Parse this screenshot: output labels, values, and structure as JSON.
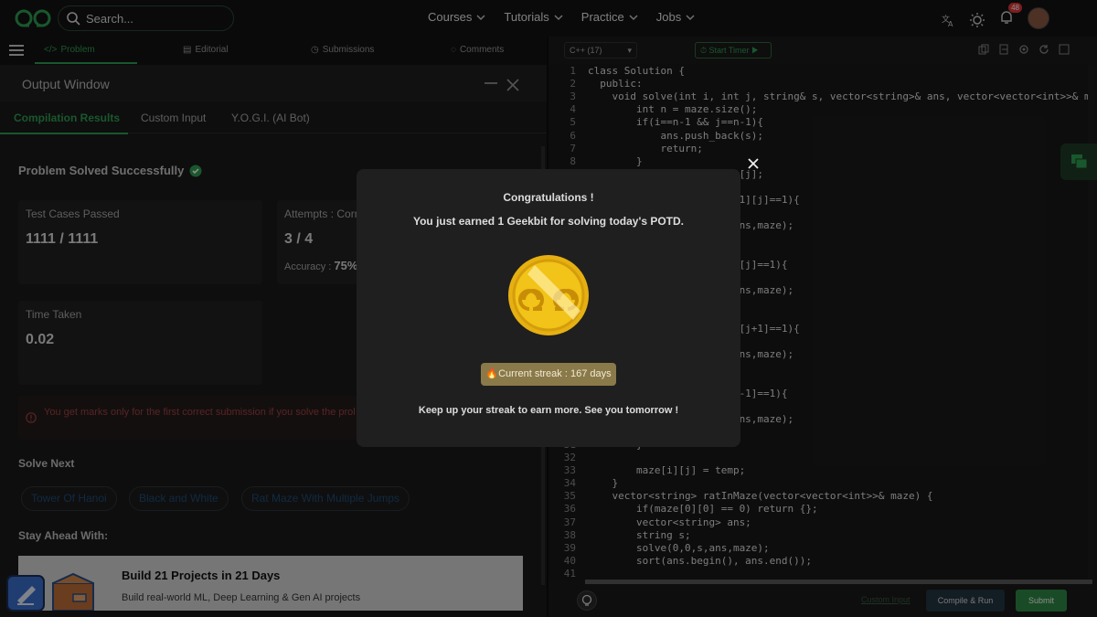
{
  "header": {
    "search_placeholder": "Search...",
    "nav": [
      "Courses",
      "Tutorials",
      "Practice",
      "Jobs"
    ],
    "notification_count": "48"
  },
  "problem_tabs": [
    "Problem",
    "Editorial",
    "Submissions",
    "Comments"
  ],
  "output_window": {
    "title": "Output Window",
    "tabs": [
      "Compilation Results",
      "Custom Input",
      "Y.O.G.I. (AI Bot)"
    ],
    "status": "Problem Solved Successfully",
    "test_cases_label": "Test Cases Passed",
    "test_cases_value": "1111 / 1111",
    "attempts_label": "Attempts : Corr",
    "attempts_value": "3 / 4",
    "accuracy_label": "Accuracy :",
    "accuracy_value": "75%",
    "time_label": "Time Taken",
    "time_value": "0.02",
    "warning": "You get marks only for the first correct submission if you solve the prol solution.",
    "solve_next_label": "Solve Next",
    "solve_next": [
      "Tower Of Hanoi",
      "Black and White",
      "Rat Maze With Multiple Jumps"
    ],
    "stay_ahead_label": "Stay Ahead With:",
    "banner_title": "Build 21 Projects in 21 Days",
    "banner_sub": "Build real-world ML, Deep Learning & Gen AI projects"
  },
  "editor": {
    "language": "C++ (17)",
    "timer_label": "Start Timer",
    "custom_input": "Custom Input",
    "compile_label": "Compile & Run",
    "submit_label": "Submit",
    "lines": [
      {
        "n": "1",
        "t": "class Solution {"
      },
      {
        "n": "2",
        "t": "  public:"
      },
      {
        "n": "3",
        "t": "    void solve(int i, int j, string& s, vector<string>& ans, vector<vector<int>>& maze"
      },
      {
        "n": "4",
        "t": "        int n = maze.size();"
      },
      {
        "n": "5",
        "t": "        if(i==n-1 && j==n-1){"
      },
      {
        "n": "6",
        "t": "            ans.push_back(s);"
      },
      {
        "n": "7",
        "t": "            return;"
      },
      {
        "n": "8",
        "t": "        }"
      },
      {
        "n": "",
        "t": "                        ][j];"
      },
      {
        "n": "",
        "t": ""
      },
      {
        "n": "",
        "t": "                        +1][j]==1){"
      },
      {
        "n": "",
        "t": ""
      },
      {
        "n": "",
        "t": "                        ans,maze);"
      },
      {
        "n": "",
        "t": ""
      },
      {
        "n": "",
        "t": ""
      },
      {
        "n": "",
        "t": "                        ][j]==1){"
      },
      {
        "n": "",
        "t": ""
      },
      {
        "n": "",
        "t": "                        ans,maze);"
      },
      {
        "n": "",
        "t": ""
      },
      {
        "n": "",
        "t": ""
      },
      {
        "n": "",
        "t": "                        ][j+1]==1){"
      },
      {
        "n": "",
        "t": ""
      },
      {
        "n": "",
        "t": "                        ans,maze);"
      },
      {
        "n": "",
        "t": ""
      },
      {
        "n": "",
        "t": ""
      },
      {
        "n": "",
        "t": "                        j-1]==1){"
      },
      {
        "n": "",
        "t": ""
      },
      {
        "n": "",
        "t": "                        ans,maze);"
      },
      {
        "n": "",
        "t": ""
      },
      {
        "n": "31",
        "t": "        }"
      },
      {
        "n": "32",
        "t": ""
      },
      {
        "n": "33",
        "t": "        maze[i][j] = temp;"
      },
      {
        "n": "34",
        "t": "    }"
      },
      {
        "n": "35",
        "t": "    vector<string> ratInMaze(vector<vector<int>>& maze) {"
      },
      {
        "n": "36",
        "t": "        if(maze[0][0] == 0) return {};"
      },
      {
        "n": "37",
        "t": "        vector<string> ans;"
      },
      {
        "n": "38",
        "t": "        string s;"
      },
      {
        "n": "39",
        "t": "        solve(0,0,s,ans,maze);"
      },
      {
        "n": "40",
        "t": "        sort(ans.begin(), ans.end());"
      },
      {
        "n": "41",
        "t": ""
      }
    ]
  },
  "modal": {
    "title": "Congratulations !",
    "message": "You just earned 1 Geekbit for solving today's POTD.",
    "streak": "Current streak : 167 days",
    "footer": "Keep up your streak to earn more. See you tomorrow !"
  },
  "colors": {
    "accent_green": "#2f9e52",
    "streak_bg": "#8a7a4a",
    "coin": "#f2c318"
  }
}
